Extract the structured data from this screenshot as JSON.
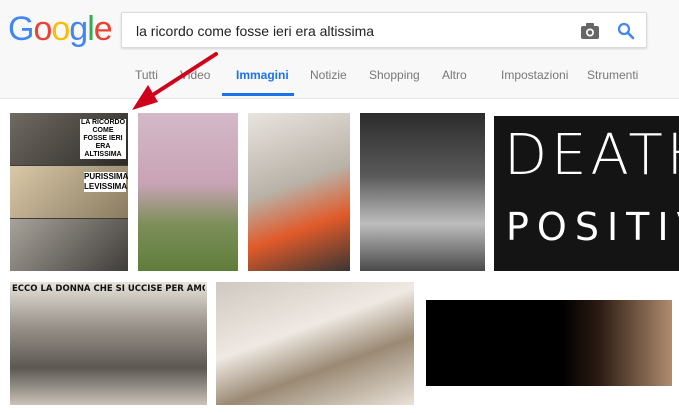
{
  "logo": {
    "letters": [
      "G",
      "o",
      "o",
      "g",
      "l",
      "e"
    ],
    "colors": [
      "#4285f4",
      "#ea4335",
      "#fbbc05",
      "#4285f4",
      "#34a853",
      "#ea4335"
    ]
  },
  "search": {
    "query": "la ricordo come fosse ieri era altissima"
  },
  "tabs": [
    {
      "label": "Tutti"
    },
    {
      "label": "Video"
    },
    {
      "label": "Immagini"
    },
    {
      "label": "Notizie"
    },
    {
      "label": "Shopping"
    },
    {
      "label": "Altro"
    },
    {
      "label": "Impostazioni"
    },
    {
      "label": "Strumenti"
    }
  ],
  "results": {
    "meme": {
      "caption_top": "LA RICORDO COME FOSSE IERI ERA ALTISSIMA",
      "caption_bottom": "PURISSIMA LEVISSIMA"
    },
    "death_positive": {
      "line1": "DEATH",
      "line2": "POSITIV"
    },
    "newspaper": {
      "headline": "ECCO LA DONNA CHE SI UCCISE PER AMORE DI TOTO"
    }
  },
  "colors": {
    "accent": "#1a73e8",
    "arrow": "#d0021b"
  }
}
